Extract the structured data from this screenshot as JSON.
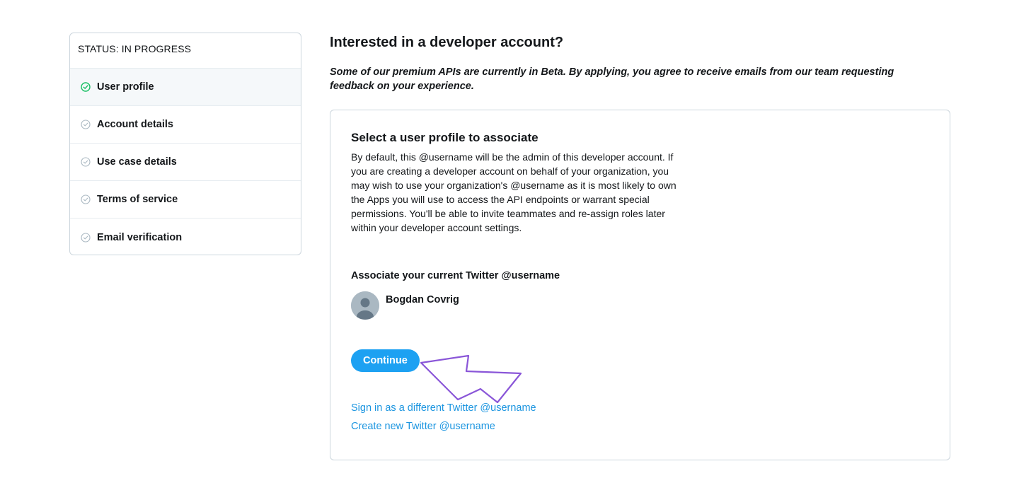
{
  "sidebar": {
    "status": "STATUS: IN PROGRESS",
    "steps": [
      {
        "label": "User profile",
        "state": "active"
      },
      {
        "label": "Account details",
        "state": "pending"
      },
      {
        "label": "Use case details",
        "state": "pending"
      },
      {
        "label": "Terms of service",
        "state": "pending"
      },
      {
        "label": "Email verification",
        "state": "pending"
      }
    ]
  },
  "main": {
    "title": "Interested in a developer account?",
    "notice": "Some of our premium APIs are currently in Beta. By applying, you agree to receive emails from our team requesting feedback on your experience.",
    "card": {
      "title": "Select a user profile to associate",
      "description": "By default, this @username will be the admin of this developer account. If you are creating a developer account on behalf of your organization, you may wish to use your organization's @username as it is most likely to own the Apps you will use to access the API endpoints or warrant special permissions. You'll be able to invite teammates and re-assign roles later within your developer account settings.",
      "associate_label": "Associate your current Twitter @username",
      "user_name": "Bogdan Covrig",
      "continue_label": "Continue",
      "link_different": "Sign in as a different Twitter @username",
      "link_create": "Create new Twitter @username"
    }
  },
  "colors": {
    "accent": "#1da1f2",
    "link": "#1b95e0",
    "check_active": "#17bf63",
    "check_pending": "#aab8c2",
    "annotation": "#8a56d8"
  },
  "icons": {
    "step_active": "check-circle-icon",
    "step_pending": "check-circle-outline-icon",
    "avatar": "default-avatar-icon",
    "annotation": "arrow-pointer-icon"
  }
}
